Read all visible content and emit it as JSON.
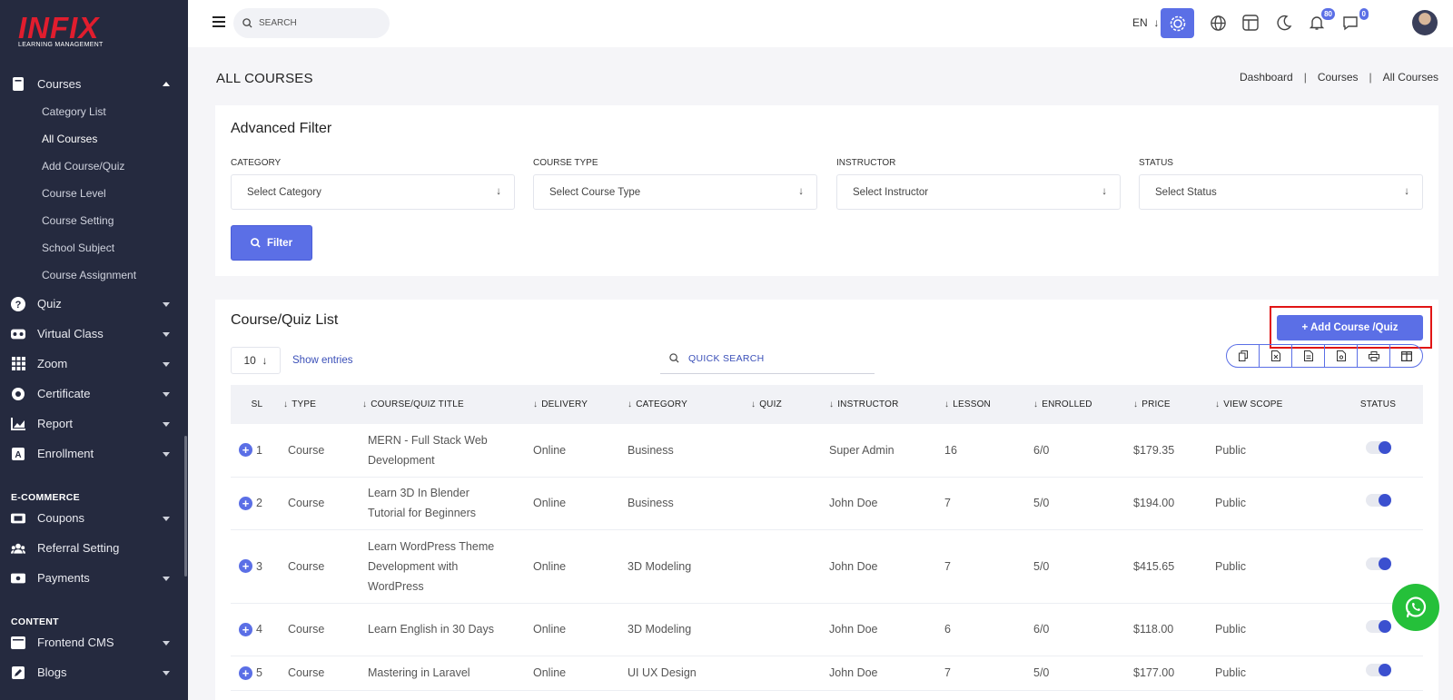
{
  "brand": {
    "logo_text": "INFIX",
    "logo_sub": "LEARNING MANAGEMENT"
  },
  "sidebar": {
    "courses_label": "Courses",
    "course_subitems": [
      "Category List",
      "All Courses",
      "Add Course/Quiz",
      "Course Level",
      "Course Setting",
      "School Subject",
      "Course Assignment"
    ],
    "items": [
      {
        "label": "Quiz",
        "icon": "question-icon"
      },
      {
        "label": "Virtual Class",
        "icon": "vr-icon"
      },
      {
        "label": "Zoom",
        "icon": "grid-icon"
      },
      {
        "label": "Certificate",
        "icon": "certificate-icon"
      },
      {
        "label": "Report",
        "icon": "chart-icon"
      },
      {
        "label": "Enrollment",
        "icon": "enrollment-icon"
      }
    ],
    "ecommerce_section": "E-COMMERCE",
    "ecommerce_items": [
      {
        "label": "Coupons",
        "icon": "coupon-icon"
      },
      {
        "label": "Referral Setting",
        "icon": "users-icon"
      },
      {
        "label": "Payments",
        "icon": "payment-icon"
      }
    ],
    "content_section": "CONTENT",
    "content_items": [
      {
        "label": "Frontend CMS",
        "icon": "cms-icon"
      },
      {
        "label": "Blogs",
        "icon": "blog-icon"
      }
    ]
  },
  "topbar": {
    "search_placeholder": "SEARCH",
    "lang": "EN",
    "notif_count": "80",
    "msg_count": "0"
  },
  "page": {
    "title": "ALL COURSES",
    "breadcrumb": [
      "Dashboard",
      "Courses",
      "All Courses"
    ]
  },
  "filter": {
    "title": "Advanced Filter",
    "fields": [
      {
        "label": "CATEGORY",
        "placeholder": "Select Category"
      },
      {
        "label": "COURSE TYPE",
        "placeholder": "Select Course Type"
      },
      {
        "label": "INSTRUCTOR",
        "placeholder": "Select Instructor"
      },
      {
        "label": "STATUS",
        "placeholder": "Select Status"
      }
    ],
    "button": "Filter"
  },
  "list": {
    "title": "Course/Quiz List",
    "add_button": "+ Add Course /Quiz",
    "entries_value": "10",
    "show_entries": "Show entries",
    "quick_search_placeholder": "QUICK SEARCH",
    "columns": [
      "SL",
      "TYPE",
      "COURSE/QUIZ TITLE",
      "DELIVERY",
      "CATEGORY",
      "QUIZ",
      "INSTRUCTOR",
      "LESSON",
      "ENROLLED",
      "PRICE",
      "VIEW SCOPE",
      "STATUS"
    ],
    "rows": [
      {
        "sl": "1",
        "type": "Course",
        "title": "MERN - Full Stack Web Development",
        "delivery": "Online",
        "category": "Business",
        "quiz": "",
        "instructor": "Super Admin",
        "lesson": "16",
        "enrolled": "6/0",
        "price": "$179.35",
        "scope": "Public"
      },
      {
        "sl": "2",
        "type": "Course",
        "title": "Learn 3D In Blender Tutorial for Beginners",
        "delivery": "Online",
        "category": "Business",
        "quiz": "",
        "instructor": "John Doe",
        "lesson": "7",
        "enrolled": "5/0",
        "price": "$194.00",
        "scope": "Public"
      },
      {
        "sl": "3",
        "type": "Course",
        "title": "Learn WordPress Theme Development with WordPress",
        "delivery": "Online",
        "category": "3D Modeling",
        "quiz": "",
        "instructor": "John Doe",
        "lesson": "7",
        "enrolled": "5/0",
        "price": "$415.65",
        "scope": "Public"
      },
      {
        "sl": "4",
        "type": "Course",
        "title": "Learn English in 30 Days",
        "delivery": "Online",
        "category": "3D Modeling",
        "quiz": "",
        "instructor": "John Doe",
        "lesson": "6",
        "enrolled": "6/0",
        "price": "$118.00",
        "scope": "Public"
      },
      {
        "sl": "5",
        "type": "Course",
        "title": "Mastering in Laravel",
        "delivery": "Online",
        "category": "UI UX Design",
        "quiz": "",
        "instructor": "John Doe",
        "lesson": "7",
        "enrolled": "5/0",
        "price": "$177.00",
        "scope": "Public"
      }
    ]
  },
  "colors": {
    "accent": "#5b6fe6",
    "sidebar_bg": "#252a3f",
    "highlight": "#e11515",
    "whatsapp": "#25c03a"
  }
}
